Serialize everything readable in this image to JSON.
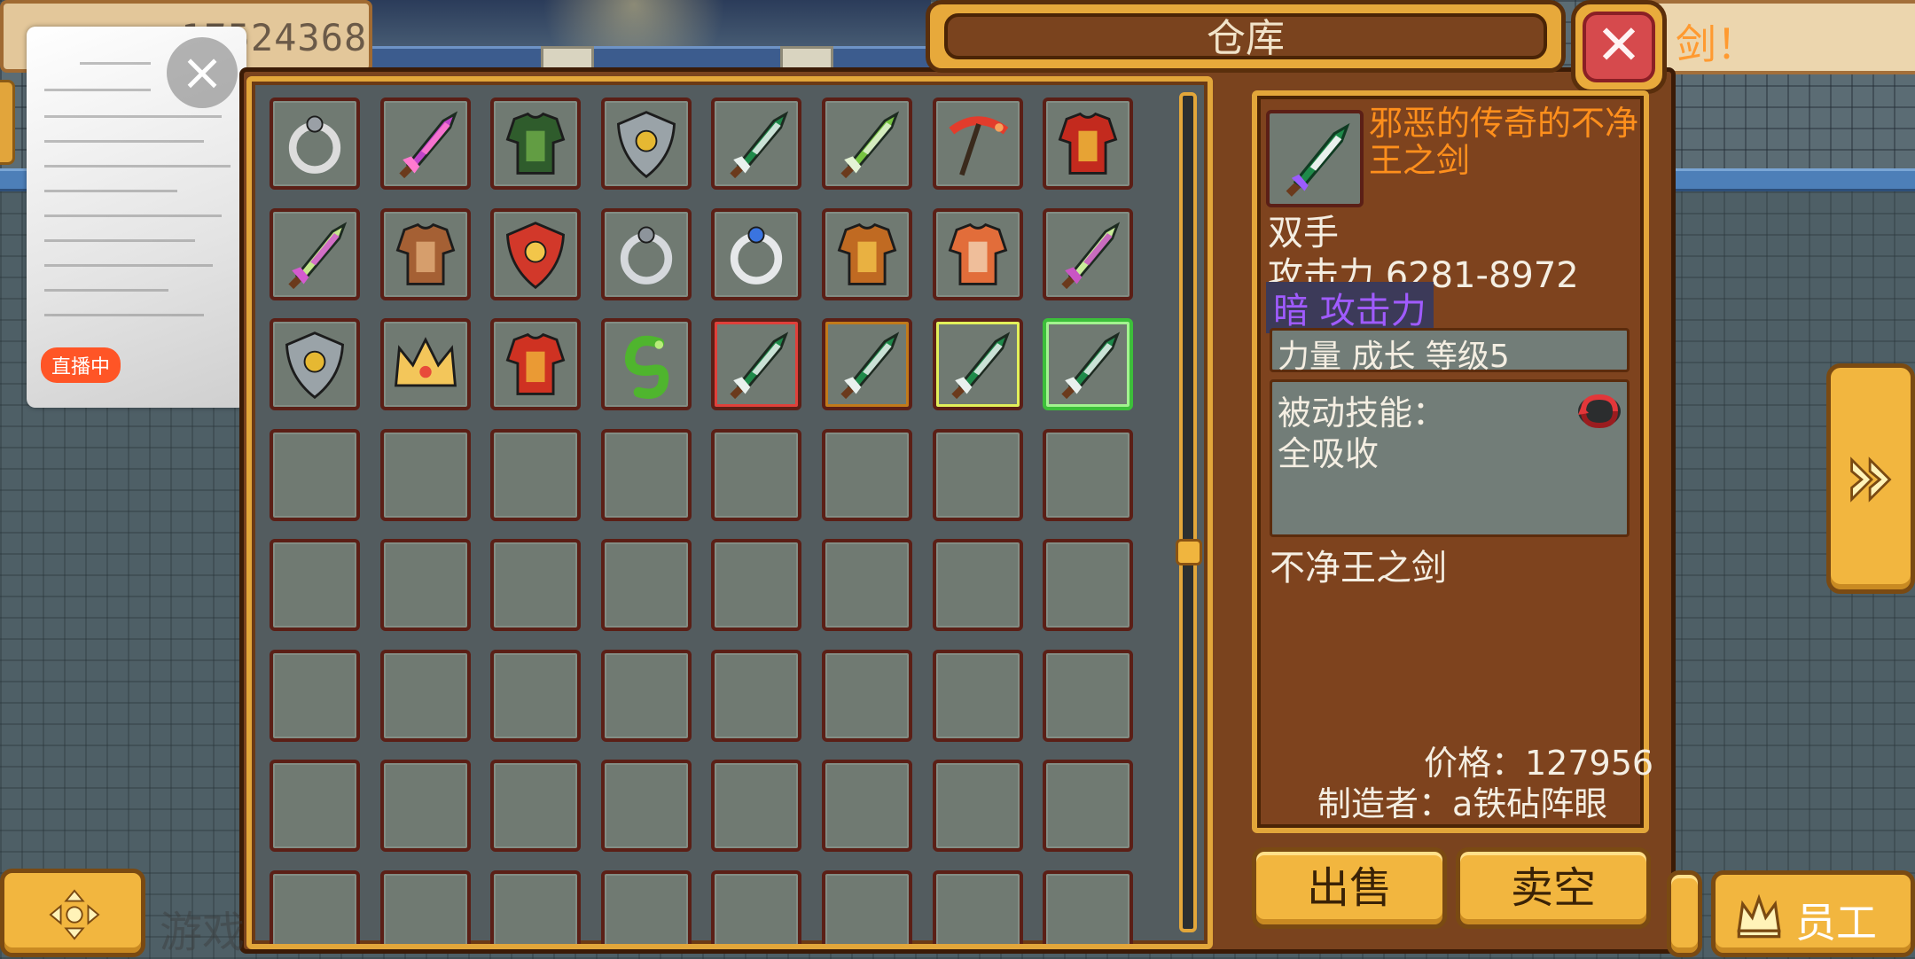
{
  "hud": {
    "money": "17524368",
    "banner_text": "剑！"
  },
  "live_overlay": {
    "badge": "直播中"
  },
  "warehouse": {
    "title": "仓库",
    "slots": [
      {
        "item": "crescent-moon-charm-icon",
        "color": "#dcdcdc",
        "accent": "#9aa0a6",
        "frame": "none"
      },
      {
        "item": "purple-broadsword-icon",
        "color": "#c045c8",
        "accent": "#ff7ad0",
        "frame": "none"
      },
      {
        "item": "green-beetle-helmet-icon",
        "color": "#2f5c2c",
        "accent": "#6fae4a",
        "frame": "none"
      },
      {
        "item": "grey-gold-shield-icon",
        "color": "#9aa3a8",
        "accent": "#e6b832",
        "frame": "none"
      },
      {
        "item": "green-leaf-blade-icon",
        "color": "#1f8a4a",
        "accent": "#e9f1ee",
        "frame": "none"
      },
      {
        "item": "jade-short-sword-icon",
        "color": "#77c441",
        "accent": "#e4f3d5",
        "frame": "none"
      },
      {
        "item": "red-pickaxe-icon",
        "color": "#e23c2c",
        "accent": "#f6a25c",
        "frame": "none"
      },
      {
        "item": "red-demon-armor-icon",
        "color": "#c32a1e",
        "accent": "#f0c23a",
        "frame": "none"
      },
      {
        "item": "pink-hilt-sword-icon",
        "color": "#c6e58c",
        "accent": "#d45bd0",
        "frame": "none"
      },
      {
        "item": "leather-armor-icon",
        "color": "#a56034",
        "accent": "#e2ae7a",
        "frame": "none"
      },
      {
        "item": "lion-crest-shield-icon",
        "color": "#d2382a",
        "accent": "#f2c64a",
        "frame": "none"
      },
      {
        "item": "silver-necklace-icon",
        "color": "#d5d8dc",
        "accent": "#8d949b",
        "frame": "none"
      },
      {
        "item": "gem-ring-icon",
        "color": "#e6e8ea",
        "accent": "#3a74e0",
        "frame": "none"
      },
      {
        "item": "bronze-chest-armor-icon",
        "color": "#c06a22",
        "accent": "#f2c34a",
        "frame": "none"
      },
      {
        "item": "orange-robe-icon",
        "color": "#e26d3a",
        "accent": "#f3d2b3",
        "frame": "none"
      },
      {
        "item": "lime-short-sword-icon",
        "color": "#c9ec9a",
        "accent": "#c956c4",
        "frame": "none"
      },
      {
        "item": "grey-gold-shield-icon",
        "color": "#9aa3a8",
        "accent": "#e6b832",
        "frame": "none"
      },
      {
        "item": "golden-crown-icon",
        "color": "#f3c65a",
        "accent": "#e84b3a",
        "frame": "none"
      },
      {
        "item": "crimson-plate-armor-icon",
        "color": "#cf3222",
        "accent": "#f0b43a",
        "frame": "none"
      },
      {
        "item": "green-serpent-icon",
        "color": "#4fb52e",
        "accent": "#b8ec7a",
        "frame": "none"
      },
      {
        "item": "green-leaf-blade-icon",
        "color": "#1f8a4a",
        "accent": "#e9f1ee",
        "frame": "#e0403a"
      },
      {
        "item": "green-leaf-blade-icon",
        "color": "#1f8a4a",
        "accent": "#e9f1ee",
        "frame": "#c27a1a"
      },
      {
        "item": "green-leaf-blade-icon",
        "color": "#1f8a4a",
        "accent": "#e9f1ee",
        "frame": "#e2f05a"
      },
      {
        "item": "green-leaf-blade-icon",
        "color": "#1f8a4a",
        "accent": "#e9f1ee",
        "frame": "#9b5cff"
      }
    ],
    "selected_slot": 23,
    "empty_slots": 40
  },
  "detail": {
    "item_icon": "green-leaf-blade-icon",
    "name": "邪恶的传奇的不净王之剑",
    "hand": "双手",
    "attack": "攻击力  6281-8972",
    "element": "暗 攻击力",
    "growth": "力量 成长 等级5",
    "skill_label": "被动技能：",
    "skill_name": "全吸收",
    "skill_icon": "red-swirl-icon",
    "base_name": "不净王之剑",
    "price": "价格：127956",
    "maker": "制造者：a铁砧阵眼"
  },
  "buttons": {
    "sell": "出售",
    "sell_all": "卖空",
    "staff": "员工"
  },
  "watermark": "游戏",
  "colors": {
    "panel_gold": "#e2a63a",
    "panel_brown": "#7e431e",
    "name_orange": "#ff8f1c",
    "element_purple": "#a05bff",
    "selected_green": "#3cbf3a"
  }
}
